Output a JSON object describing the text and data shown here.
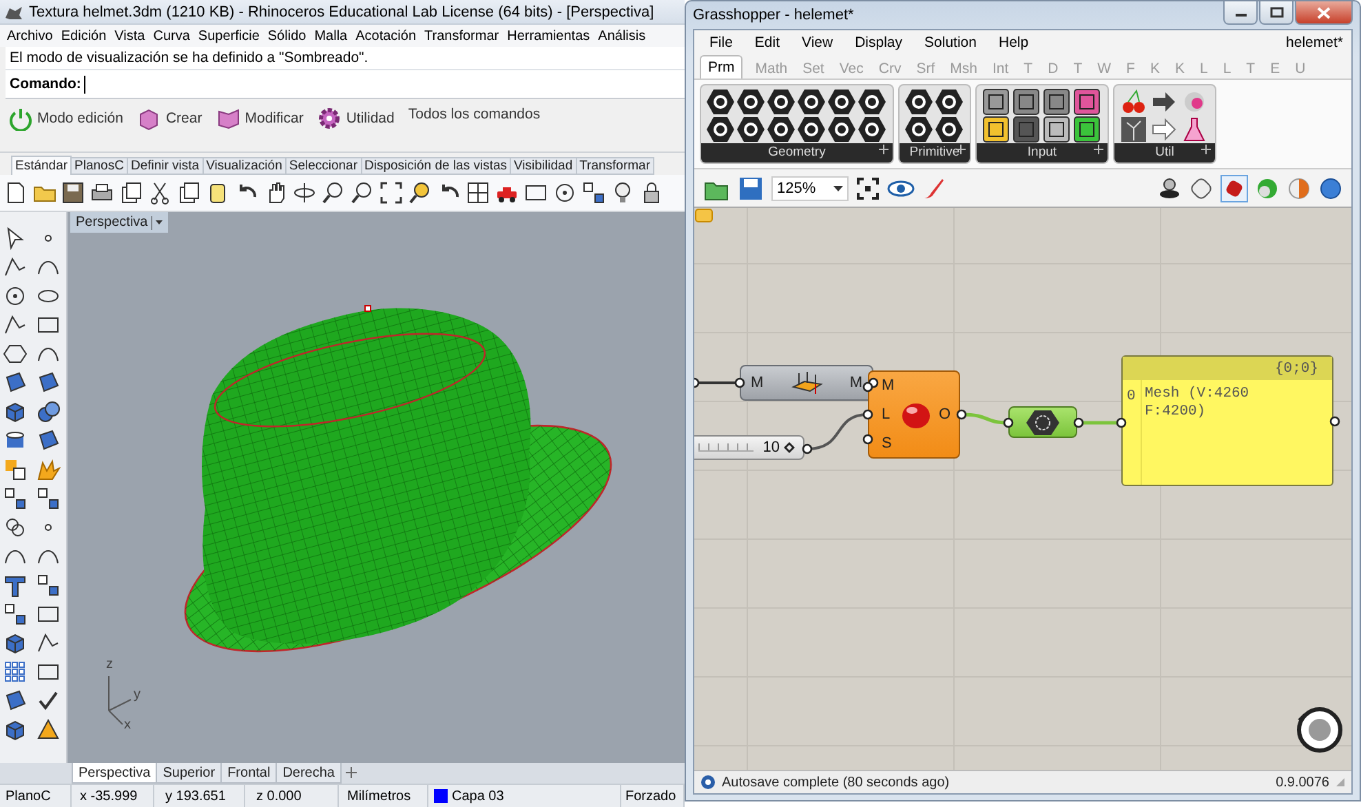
{
  "rhino": {
    "title": "Textura helmet.3dm (1210 KB) - Rhinoceros Educational Lab License (64 bits) - [Perspectiva]",
    "menu": [
      "Archivo",
      "Edición",
      "Vista",
      "Curva",
      "Superficie",
      "Sólido",
      "Malla",
      "Acotación",
      "Transformar",
      "Herramientas",
      "Análisis"
    ],
    "history": "El modo de visualización se ha definido a \"Sombreado\".",
    "command_label": "Comando:",
    "command_groups": [
      {
        "label": "Modo edición",
        "kind": "power"
      },
      {
        "label": "Crear",
        "kind": "cube"
      },
      {
        "label": "Modificar",
        "kind": "sheet"
      },
      {
        "label": "Utilidad",
        "kind": "gear"
      },
      {
        "label": "Todos los comandos",
        "kind": "plain"
      }
    ],
    "tabs": [
      {
        "label": "Estándar",
        "selected": true
      },
      {
        "label": "PlanosC",
        "selected": false
      },
      {
        "label": "Definir vista",
        "selected": false
      },
      {
        "label": "Visualización",
        "selected": false
      },
      {
        "label": "Seleccionar",
        "selected": false
      },
      {
        "label": "Disposición de las vistas",
        "selected": false
      },
      {
        "label": "Visibilidad",
        "selected": false
      },
      {
        "label": "Transformar",
        "selected": false
      }
    ],
    "viewport": {
      "label": "Perspectiva",
      "axes": [
        "z",
        "y",
        "x"
      ]
    },
    "viewport_tabs": [
      {
        "label": "Perspectiva",
        "selected": true
      },
      {
        "label": "Superior",
        "selected": false
      },
      {
        "label": "Frontal",
        "selected": false
      },
      {
        "label": "Derecha",
        "selected": false
      }
    ],
    "status": {
      "cplane": "PlanoC",
      "x": "x -35.999",
      "y": "y 193.651",
      "z": "z 0.000",
      "units": "Milímetros",
      "layer": "Capa 03",
      "osnap": "Forzado"
    }
  },
  "grasshopper": {
    "title": "Grasshopper - helemet*",
    "menu": [
      "File",
      "Edit",
      "View",
      "Display",
      "Solution",
      "Help"
    ],
    "document": "helemet*",
    "tabs": [
      {
        "label": "Prm",
        "selected": true
      },
      {
        "label": "Math",
        "selected": false
      },
      {
        "label": "Set",
        "selected": false
      },
      {
        "label": "Vec",
        "selected": false
      },
      {
        "label": "Crv",
        "selected": false
      },
      {
        "label": "Srf",
        "selected": false
      },
      {
        "label": "Msh",
        "selected": false
      },
      {
        "label": "Int",
        "selected": false
      },
      {
        "label": "T",
        "selected": false
      },
      {
        "label": "D",
        "selected": false
      },
      {
        "label": "T",
        "selected": false
      },
      {
        "label": "W",
        "selected": false
      },
      {
        "label": "F",
        "selected": false
      },
      {
        "label": "K",
        "selected": false
      },
      {
        "label": "K",
        "selected": false
      },
      {
        "label": "L",
        "selected": false
      },
      {
        "label": "L",
        "selected": false
      },
      {
        "label": "T",
        "selected": false
      },
      {
        "label": "E",
        "selected": false
      },
      {
        "label": "U",
        "selected": false
      }
    ],
    "groups": [
      {
        "label": "Geometry",
        "kind": "geometry"
      },
      {
        "label": "Primitive",
        "kind": "primitive"
      },
      {
        "label": "Input",
        "kind": "input"
      },
      {
        "label": "Util",
        "kind": "util"
      }
    ],
    "zoom": "125%",
    "mesh_component": {
      "input": "M",
      "output": "M"
    },
    "slider": {
      "value": "10",
      "level": 1
    },
    "component": {
      "inputs": [
        "M",
        "L",
        "S"
      ],
      "output": "O"
    },
    "panel": {
      "header": "{0;0}",
      "index": "0",
      "lines": [
        "Mesh (V:4260",
        "F:4200)"
      ]
    },
    "status": "Autosave complete (80 seconds ago)",
    "version": "0.9.0076"
  }
}
